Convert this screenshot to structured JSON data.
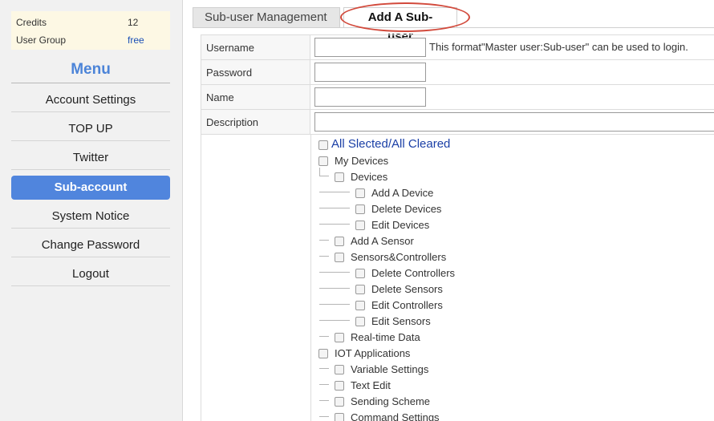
{
  "sidebar": {
    "info": {
      "credits_label": "Credits",
      "credits_value": "12",
      "group_label": "User Group",
      "group_value": "free"
    },
    "menu_title": "Menu",
    "items": [
      {
        "label": "Account Settings"
      },
      {
        "label": "TOP UP"
      },
      {
        "label": "Twitter"
      },
      {
        "label": "Sub-account",
        "active": true
      },
      {
        "label": "System Notice"
      },
      {
        "label": "Change Password"
      },
      {
        "label": "Logout"
      }
    ]
  },
  "tabs": {
    "management": "Sub-user Management",
    "add": "Add A Sub-user"
  },
  "form": {
    "username_label": "Username",
    "username_hint": "This format\"Master user:Sub-user\" can be used to login.",
    "password_label": "Password",
    "name_label": "Name",
    "description_label": "Description"
  },
  "permissions": {
    "all_toggle": "All Slected/All Cleared",
    "items": [
      {
        "label": "My Devices"
      },
      {
        "label": "Devices"
      },
      {
        "label": "Add A Device"
      },
      {
        "label": "Delete Devices"
      },
      {
        "label": "Edit Devices"
      },
      {
        "label": "Add A Sensor"
      },
      {
        "label": "Sensors&Controllers"
      },
      {
        "label": "Delete Controllers"
      },
      {
        "label": "Delete Sensors"
      },
      {
        "label": "Edit Controllers"
      },
      {
        "label": "Edit Sensors"
      },
      {
        "label": "Real-time Data"
      },
      {
        "label": "IOT Applications"
      },
      {
        "label": "Variable Settings"
      },
      {
        "label": "Text Edit"
      },
      {
        "label": "Sending Scheme"
      },
      {
        "label": "Command Settings"
      }
    ]
  },
  "colors": {
    "accent": "#5085dd",
    "highlight_oval": "#d24a3c",
    "info_bg": "#fdf8e4"
  }
}
